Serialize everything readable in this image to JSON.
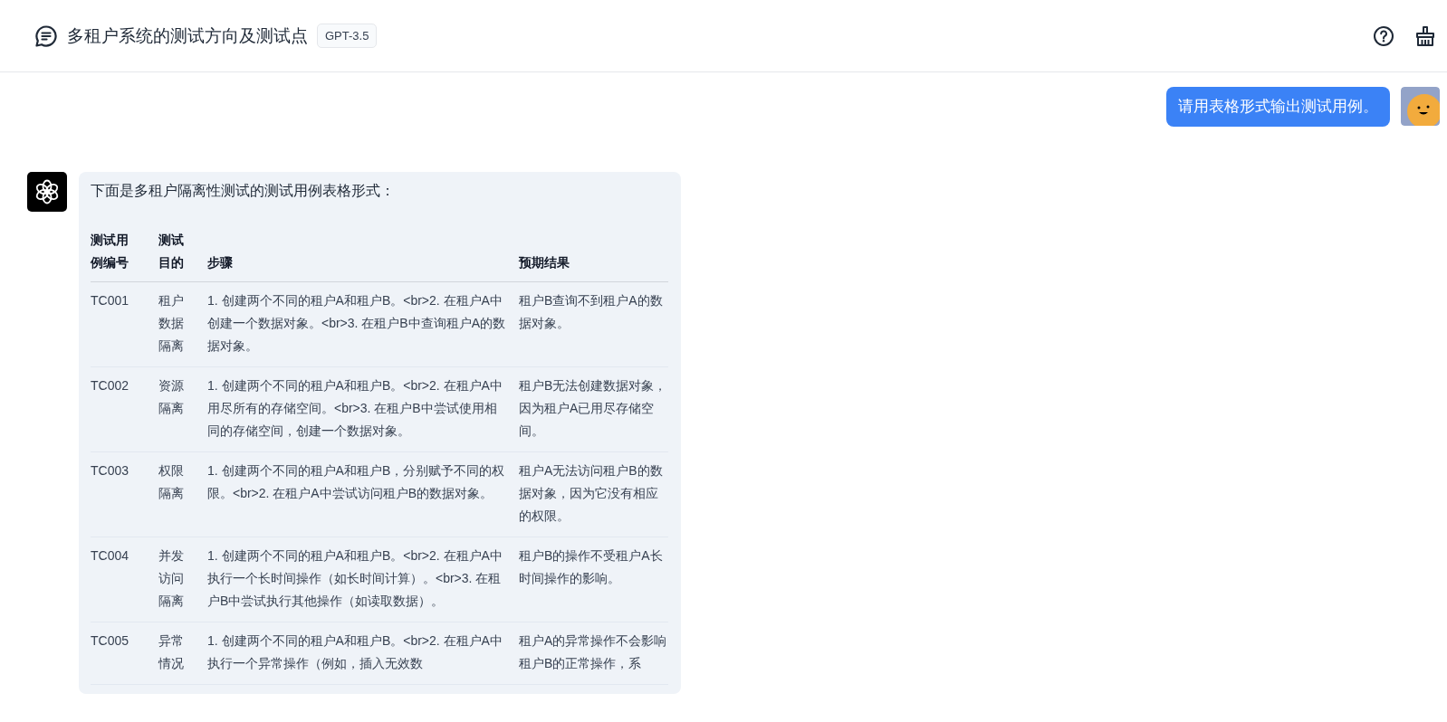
{
  "header": {
    "title": "多租户系统的测试方向及测试点",
    "model_badge": "GPT-3.5"
  },
  "messages": [
    {
      "kind": "user",
      "text": "请用表格形式输出测试用例。"
    },
    {
      "kind": "assistant",
      "intro": "下面是多租户隔离性测试的测试用例表格形式：",
      "table": {
        "columns": [
          "测试用例编号",
          "测试目的",
          "步骤",
          "预期结果"
        ],
        "rows": [
          [
            "TC001",
            "租户数据隔离",
            "1. 创建两个不同的租户A和租户B。<br>2. 在租户A中创建一个数据对象。<br>3. 在租户B中查询租户A的数据对象。",
            "租户B查询不到租户A的数据对象。"
          ],
          [
            "TC002",
            "资源隔离",
            "1. 创建两个不同的租户A和租户B。<br>2. 在租户A中用尽所有的存储空间。<br>3. 在租户B中尝试使用相同的存储空间，创建一个数据对象。",
            "租户B无法创建数据对象，因为租户A已用尽存储空间。"
          ],
          [
            "TC003",
            "权限隔离",
            "1. 创建两个不同的租户A和租户B，分别赋予不同的权限。<br>2. 在租户A中尝试访问租户B的数据对象。",
            "租户A无法访问租户B的数据对象，因为它没有相应的权限。"
          ],
          [
            "TC004",
            "并发访问隔离",
            "1. 创建两个不同的租户A和租户B。<br>2. 在租户A中执行一个长时间操作（如长时间计算）。<br>3. 在租户B中尝试执行其他操作（如读取数据）。",
            "租户B的操作不受租户A长时间操作的影响。"
          ],
          [
            "TC005",
            "异常情况",
            "1. 创建两个不同的租户A和租户B。<br>2. 在租户A中执行一个异常操作（例如，插入无效数",
            "租户A的异常操作不会影响租户B的正常操作，系"
          ]
        ]
      }
    }
  ]
}
